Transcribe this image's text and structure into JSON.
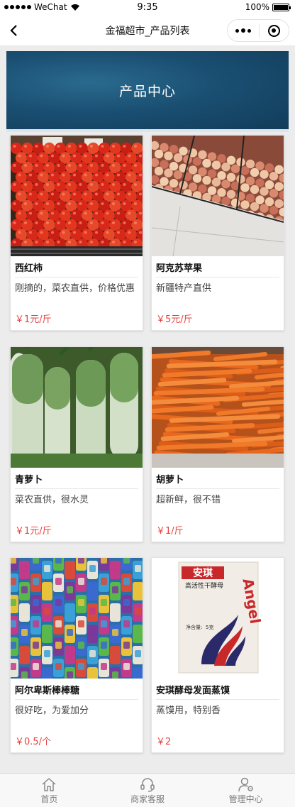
{
  "status": {
    "carrier": "WeChat",
    "time": "9:35",
    "battery": "100%",
    "battery_level": 1.0
  },
  "nav": {
    "title": "金福超市_产品列表"
  },
  "banner": {
    "title": "产品中心"
  },
  "products": [
    {
      "name": "西红柿",
      "desc": "刚摘的，菜农直供，价格优惠",
      "price": "￥1元/斤",
      "image": "tomatoes"
    },
    {
      "name": "阿克苏苹果",
      "desc": "新疆特产直供",
      "price": "￥5元/斤",
      "image": "apples"
    },
    {
      "name": "青萝卜",
      "desc": "菜农直供，很水灵",
      "price": "￥1元/斤",
      "image": "green-radishes"
    },
    {
      "name": "胡萝卜",
      "desc": "超新鲜，很不错",
      "price": "￥1/斤",
      "image": "carrots"
    },
    {
      "name": "阿尔卑斯棒棒糖",
      "desc": "很好吃，为爱加分",
      "price": "￥0.5/个",
      "image": "lollipops"
    },
    {
      "name": "安琪酵母发面蒸馍",
      "desc": "蒸馍用，特别香",
      "price": "￥2",
      "image": "angel-yeast-pack"
    }
  ],
  "yeast_pack_text": {
    "brand_cn": "安琪",
    "brand_en": "Angel",
    "subtitle": "高活性干酵母",
    "weight": "5克"
  },
  "tabs": [
    {
      "label": "首页",
      "icon": "home-icon"
    },
    {
      "label": "商家客服",
      "icon": "headset-icon"
    },
    {
      "label": "管理中心",
      "icon": "user-settings-icon"
    }
  ],
  "colors": {
    "price": "#e64340",
    "banner": "#1a4f72"
  }
}
